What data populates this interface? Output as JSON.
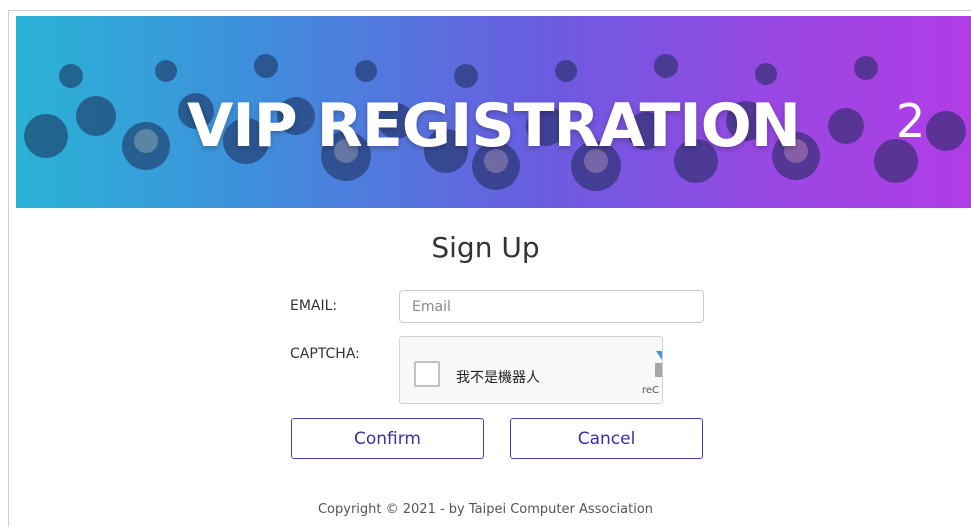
{
  "banner": {
    "title": "VIP REGISTRATION",
    "number": "2"
  },
  "form": {
    "heading": "Sign Up",
    "email_label": "EMAIL:",
    "email_placeholder": "Email",
    "email_value": "",
    "captcha_label": "CAPTCHA:",
    "captcha_checkbox_text": "我不是機器人",
    "captcha_brand": "reC",
    "captcha_icon": "recaptcha-icon"
  },
  "buttons": {
    "confirm_label": "Confirm",
    "cancel_label": "Cancel"
  },
  "footer": {
    "copyright": "Copyright © 2021 - by Taipei Computer Association"
  },
  "colors": {
    "banner_gradient_start": "#2ab3d6",
    "banner_gradient_end": "#b03de6",
    "button_border": "#4a3fb5",
    "button_text": "#3a2fa8"
  }
}
